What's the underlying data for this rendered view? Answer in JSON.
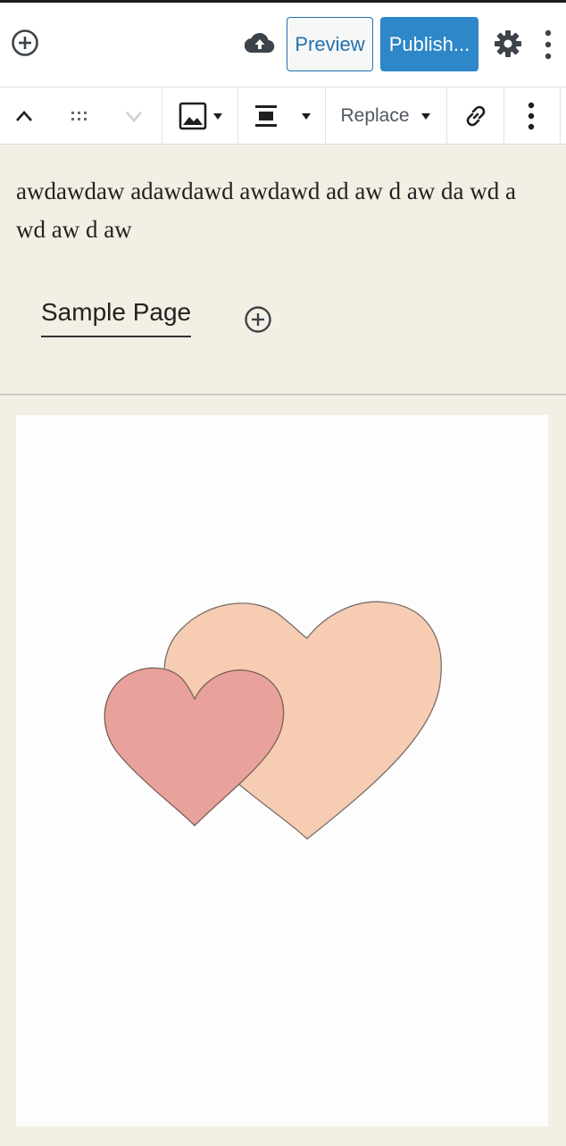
{
  "header": {
    "preview_label": "Preview",
    "publish_label": "Publish...",
    "icons": [
      "add-block-icon",
      "cloud-upload-icon",
      "gear-icon",
      "more-vertical-icon"
    ]
  },
  "toolbar": {
    "replace_label": "Replace",
    "icons": [
      "chevron-up-icon",
      "drag-handle-icon",
      "chevron-down-icon",
      "image-icon",
      "caret-down-icon",
      "align-center-icon",
      "caret-down-icon",
      "caret-down-icon",
      "link-icon",
      "more-vertical-icon"
    ]
  },
  "content": {
    "paragraph": "awdawdaw adawdawd awdawd ad aw d aw da wd a wd aw d aw",
    "nav_item": "Sample Page"
  },
  "colors": {
    "accent": "#2e87c8",
    "preview_text": "#2271b1",
    "page_bg": "#f4efe4",
    "heart_large": "#f6cdb3",
    "heart_small": "#e8a29b"
  }
}
